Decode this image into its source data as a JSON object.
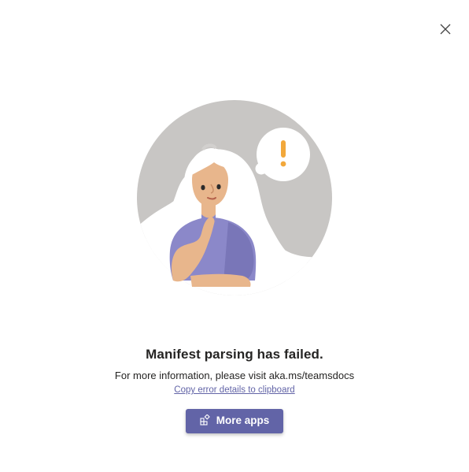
{
  "dialog": {
    "title": "Manifest parsing has failed.",
    "info_text": "For more information, please visit aka.ms/teamsdocs",
    "copy_link_label": "Copy error details to clipboard",
    "primary_button_label": "More apps",
    "close_icon": "close-icon",
    "button_icon": "apps-icon",
    "illustration": "person-thinking-with-exclamation-bubble"
  },
  "colors": {
    "accent": "#6264a7",
    "text": "#252423",
    "background": "#ffffff",
    "illustration_circle": "#c8c6c4",
    "exclamation": "#f2a83b"
  }
}
